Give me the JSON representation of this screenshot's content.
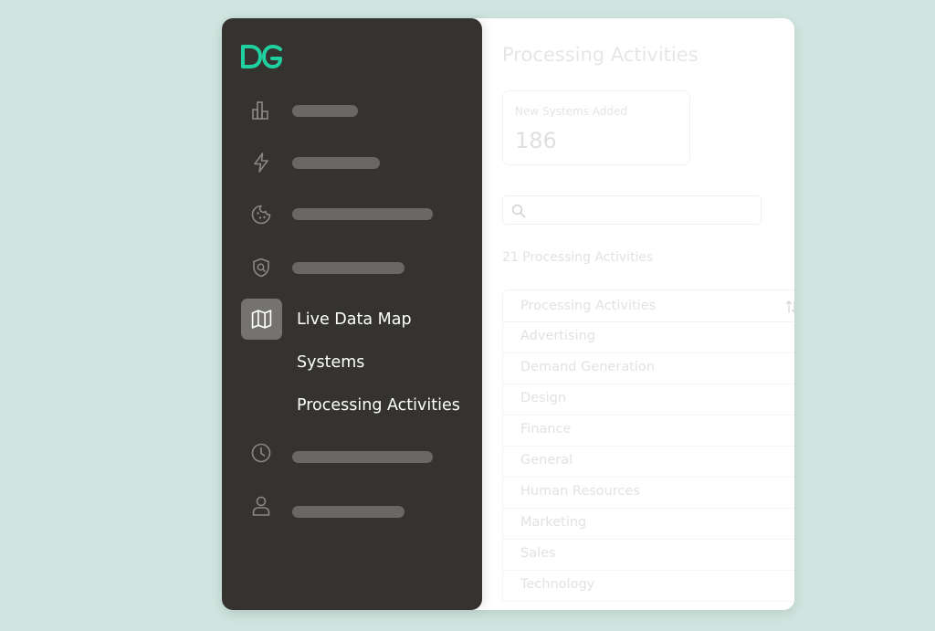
{
  "main": {
    "title": "Processing Activities",
    "stat_card": {
      "label": "New Systems Added",
      "value": "186"
    },
    "search": {
      "value": "",
      "placeholder": ""
    },
    "result_count": "21 Processing Activities",
    "table": {
      "header": "Processing Activities",
      "rows": [
        "Advertising",
        "Demand Generation",
        "Design",
        "Finance",
        "General",
        "Human Resources",
        "Marketing",
        "Sales",
        "Technology"
      ]
    }
  },
  "sidebar": {
    "logo_icon": "dg-logo-icon",
    "items": [
      {
        "icon": "bar-chart-icon"
      },
      {
        "icon": "lightning-icon"
      },
      {
        "icon": "cookie-icon"
      },
      {
        "icon": "shield-search-icon"
      },
      {
        "icon": "map-icon",
        "label": "Live Data Map",
        "active": true
      },
      {
        "label": "Systems"
      },
      {
        "label": "Processing Activities"
      },
      {
        "icon": "clock-icon"
      },
      {
        "icon": "user-icon"
      }
    ],
    "colors": {
      "background": "#353330",
      "accent": "#1fd1a0",
      "active_tile": "#75736f",
      "placeholder_bar": "#6a6866"
    }
  },
  "colors": {
    "page_background": "#d0e5df",
    "window_background": "#ffffff"
  }
}
